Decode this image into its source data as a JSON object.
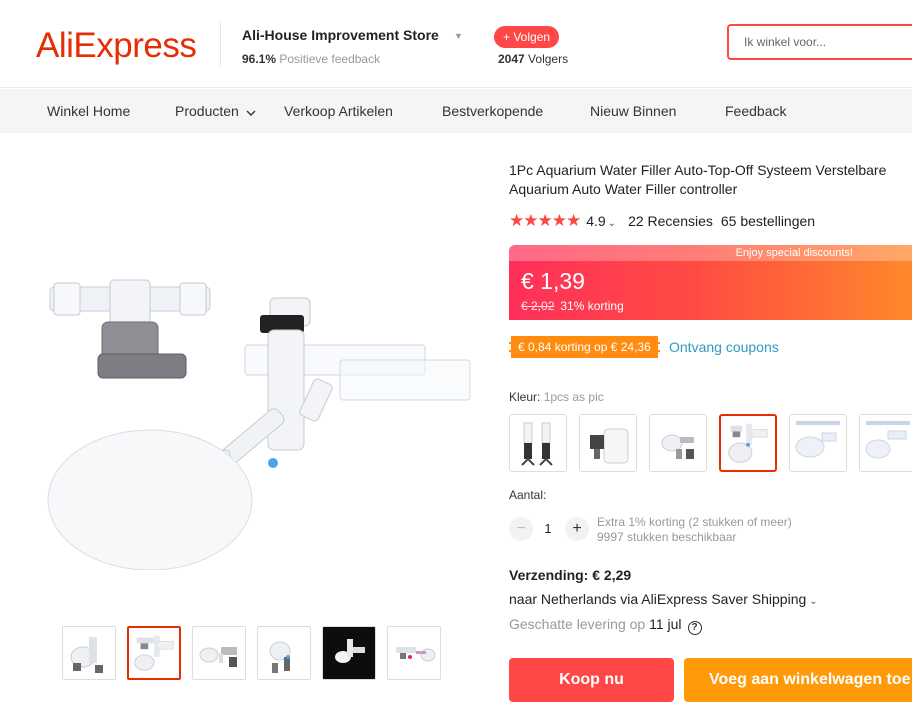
{
  "header": {
    "logo": "AliExpress",
    "store_name": "Ali-House Improvement Store",
    "feedback_percent": "96.1%",
    "feedback_label": "Positieve feedback",
    "follow_label": "+ Volgen",
    "followers_count": "2047",
    "followers_label": "Volgers",
    "search_placeholder": "Ik winkel voor..."
  },
  "nav": {
    "items": [
      "Winkel Home",
      "Producten",
      "Verkoop Artikelen",
      "Bestverkopende",
      "Nieuw Binnen",
      "Feedback"
    ]
  },
  "product": {
    "title": "1Pc Aquarium Water Filler Auto-Top-Off Systeem Verstelbare Aquarium Auto Water Filler controller",
    "stars": "★★★★★",
    "rating": "4.9",
    "reviews": "22 Recensies",
    "orders": "65 bestellingen",
    "promo_banner": "Enjoy special discounts!",
    "price": "€ 1,39",
    "original_price": "€ 2,02",
    "discount": "31% korting",
    "coupon": "€ 0,84 korting op € 24,36",
    "coupon_link": "Ontvang coupons",
    "color_label": "Kleur:",
    "color_value": "1pcs as pic",
    "sku_selected_index": 3,
    "thumb_selected_index": 1,
    "quantity_label": "Aantal:",
    "quantity": "1",
    "qty_minus": "−",
    "qty_plus": "+",
    "qty_discount": "Extra 1% korting (2 stukken of meer)",
    "qty_stock": "9997 stukken beschikbaar",
    "shipping_label": "Verzending: € 2,29",
    "shipping_dest": "naar Netherlands via AliExpress Saver Shipping",
    "delivery_label": "Geschatte levering op",
    "delivery_date": "11 jul",
    "buy_now": "Koop nu",
    "add_to_cart": "Voeg aan winkelwagen toe"
  },
  "colors": {
    "brand": "#e62e04",
    "accent_red": "#ff4747",
    "orange": "#ff9a0a",
    "link": "#2e9cc3"
  }
}
